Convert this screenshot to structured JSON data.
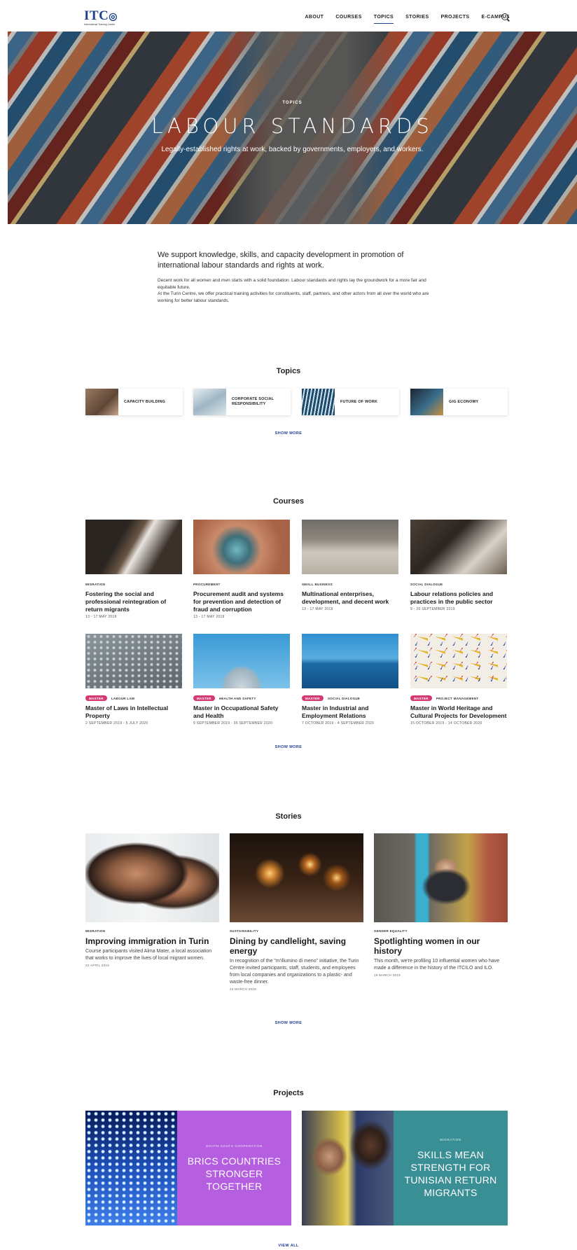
{
  "header": {
    "logo": "ITC",
    "logo_sub": "International Training Centre",
    "nav": [
      "ABOUT",
      "COURSES",
      "TOPICS",
      "STORIES",
      "PROJECTS",
      "E-CAMPUS"
    ],
    "active_nav": "TOPICS"
  },
  "hero": {
    "kicker": "TOPICS",
    "title": "LABOUR STANDARDS",
    "subtitle": "Legally-established rights at work, backed by governments, employers, and workers."
  },
  "intro": {
    "lead": "We support knowledge, skills, and capacity development in promotion of international labour standards and rights at work.",
    "p1": "Decent work for all women and men starts with a solid foundation. Labour standards and rights lay the groundwork for a more fair and equitable future.",
    "p2": "At the Turin Centre, we offer practical training activities for constituents, staff, partners, and other actors from all over the world who are working for better labour standards."
  },
  "topics": {
    "title": "Topics",
    "items": [
      "CAPACITY BUILDING",
      "CORPORATE SOCIAL RESPONSIBILITY",
      "FUTURE OF WORK",
      "GIG ECONOMY"
    ],
    "show_more": "SHOW MORE"
  },
  "courses": {
    "title": "Courses",
    "items": [
      {
        "badge": "",
        "tag": "MIGRATION",
        "title": "Fostering the social and professional reintegration of return migrants",
        "date": "13 - 17 MAY 2019"
      },
      {
        "badge": "",
        "tag": "PROCUREMENT",
        "title": "Procurement audit and systems for prevention and detection of fraud and corruption",
        "date": "13 - 17 MAY 2019"
      },
      {
        "badge": "",
        "tag": "SMALL BUSINESS",
        "title": "Multinational enterprises, development, and decent work",
        "date": "13 - 17 MAY 2019"
      },
      {
        "badge": "",
        "tag": "SOCIAL DIALOGUE",
        "title": "Labour relations policies and practices in the public sector",
        "date": "9 - 20 SEPTEMBER 2019"
      },
      {
        "badge": "MASTER",
        "tag": "LABOUR LAW",
        "title": "Master of Laws in Intellectual Property",
        "date": "2 SEPTEMBER 2019 - 5 JULY 2020"
      },
      {
        "badge": "MASTER",
        "tag": "HEALTH AND SAFETY",
        "title": "Master in Occupational Safety and Health",
        "date": "9 SEPTEMBER 2019 - 30 SEPTEMBER 2020"
      },
      {
        "badge": "MASTER",
        "tag": "SOCIAL DIALOGUE",
        "title": "Master in Industrial and Employment Relations",
        "date": "7 OCTOBER 2019 - 4 SEPTEMBER 2020"
      },
      {
        "badge": "MASTER",
        "tag": "PROJECT MANAGEMENT",
        "title": "Master in World Heritage and Cultural Projects for Development",
        "date": "15 OCTOBER 2019 - 14 OCTOBER 2020"
      }
    ],
    "show_more": "SHOW MORE"
  },
  "stories": {
    "title": "Stories",
    "items": [
      {
        "tag": "MIGRATION",
        "title": "Improving immigration in Turin",
        "text": "Course participants visited Alma Mater, a local association that works to improve the lives of local migrant women.",
        "date": "22 APRIL 2019"
      },
      {
        "tag": "SUSTAINABILITY",
        "title": "Dining by candlelight, saving energy",
        "text": "In recognition of the \"m'illumino di meno\" initiative, the Turin Centre invited participants, staff, students, and employees from local companies and organizations to a plastic- and waste-free dinner.",
        "date": "23 MARCH 2019"
      },
      {
        "tag": "GENDER EQUALITY",
        "title": "Spotlighting women in our history",
        "text": "This month, we're profiling 10 influential women who have made a difference in the history of the ITCILO and ILO.",
        "date": "19 MARCH 2019"
      }
    ],
    "show_more": "SHOW MORE"
  },
  "projects": {
    "title": "Projects",
    "items": [
      {
        "kicker": "SOUTH-SOUTH COOPERATION",
        "title": "BRICS COUNTRIES STRONGER TOGETHER",
        "color": "#b65ee0"
      },
      {
        "kicker": "MIGRATION",
        "title": "SKILLS MEAN STRENGTH FOR TUNISIAN RETURN MIGRANTS",
        "color": "#3a8f95"
      }
    ],
    "view_all": "VIEW ALL"
  },
  "colors": {
    "brand": "#1e3f8f",
    "badge": "#d43a73"
  }
}
